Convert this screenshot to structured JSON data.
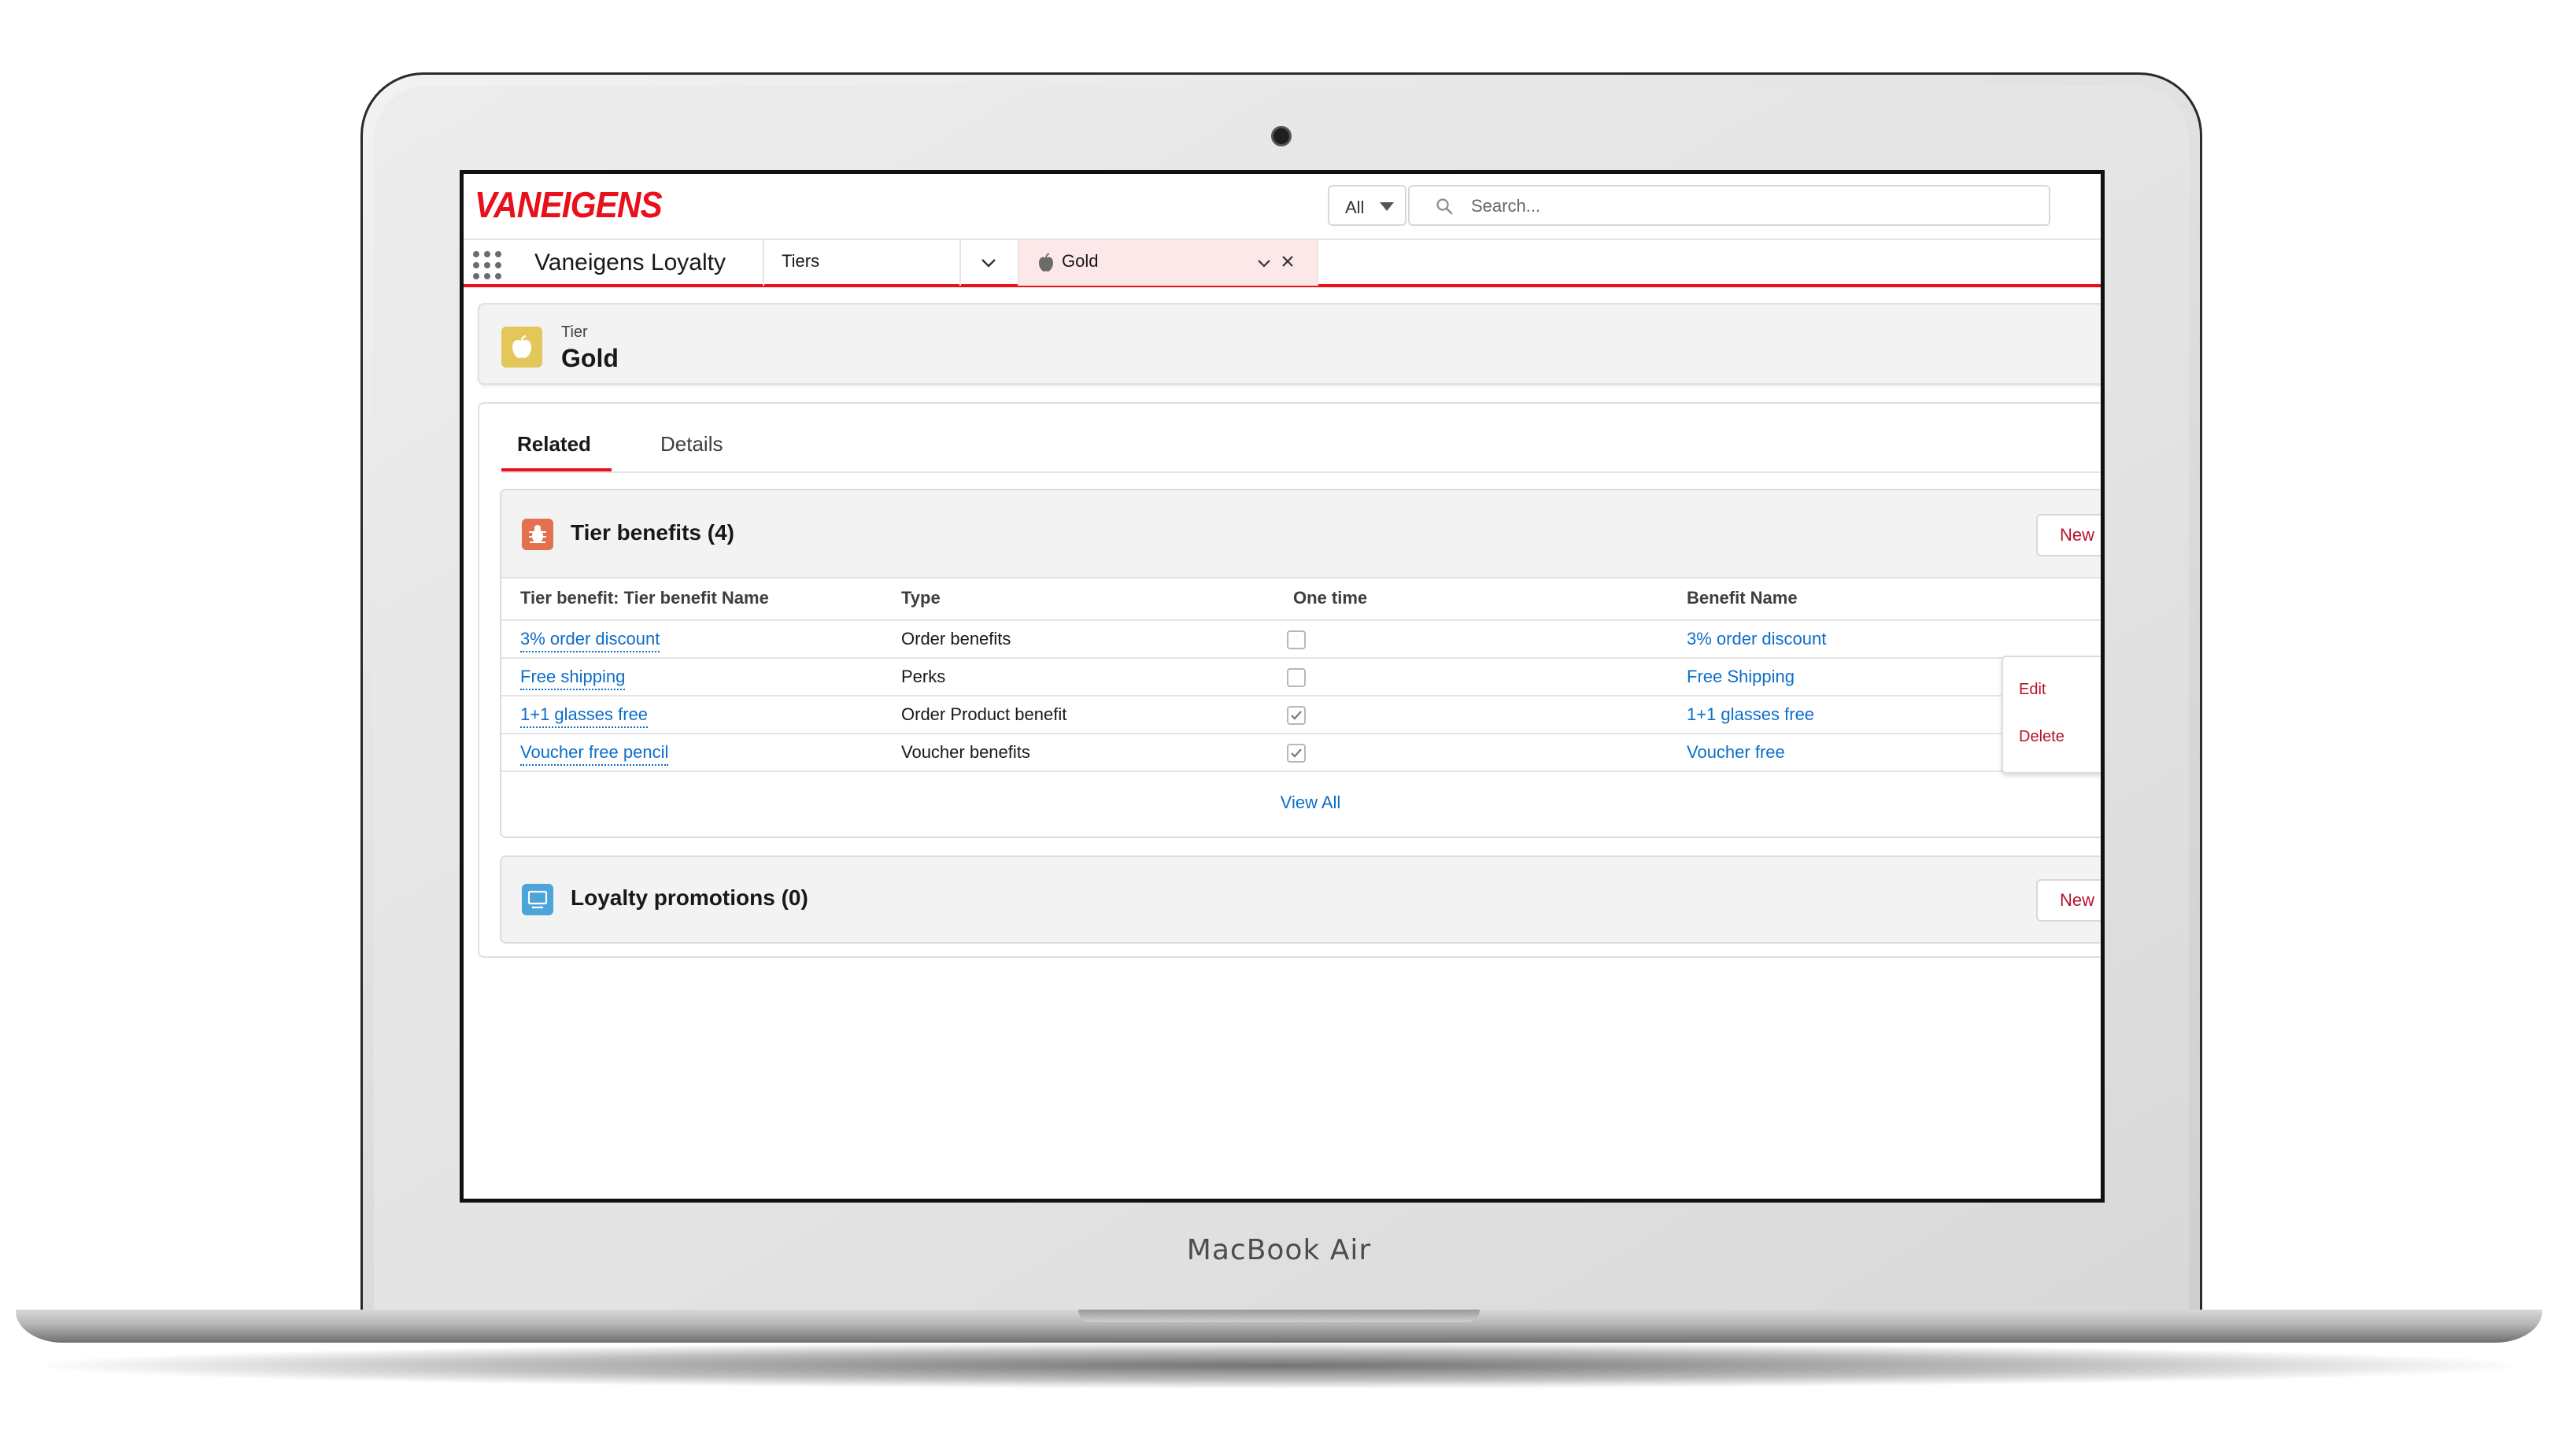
{
  "device": {
    "label": "MacBook Air"
  },
  "header": {
    "logo_text": "VANEIGENS",
    "search_scope": "All",
    "search_placeholder": "Search..."
  },
  "navbar": {
    "app_name": "Vaneigens Loyalty",
    "items": [
      {
        "label": "Tiers"
      }
    ],
    "open_tab": {
      "label": "Gold"
    }
  },
  "record": {
    "type_label": "Tier",
    "name": "Gold",
    "icon": "apple-icon"
  },
  "tabs": [
    {
      "label": "Related",
      "active": true
    },
    {
      "label": "Details",
      "active": false
    }
  ],
  "tier_benefits": {
    "title": "Tier benefits (4)",
    "new_label": "New",
    "columns": [
      "Tier benefit: Tier benefit Name",
      "Type",
      "One time",
      "Benefit Name"
    ],
    "rows": [
      {
        "name": "3% order discount",
        "type": "Order benefits",
        "one_time": false,
        "benefit": "3% order discount"
      },
      {
        "name": "Free shipping",
        "type": "Perks",
        "one_time": false,
        "benefit": "Free Shipping"
      },
      {
        "name": "1+1 glasses free",
        "type": "Order Product benefit",
        "one_time": true,
        "benefit": "1+1 glasses free"
      },
      {
        "name": "Voucher free pencil",
        "type": "Voucher benefits",
        "one_time": true,
        "benefit": "Voucher free"
      }
    ],
    "view_all": "View All",
    "row_menu": {
      "items": [
        "Edit",
        "Delete"
      ]
    }
  },
  "loyalty_promotions": {
    "title": "Loyalty promotions (0)",
    "new_label": "New"
  },
  "colors": {
    "brand_red": "#e8101b",
    "link_blue": "#0b6ec9",
    "action_red": "#b5122c",
    "tier_icon": "#e3c75b",
    "benefits_icon": "#e3714f",
    "promotions_icon": "#4ba5d9"
  }
}
